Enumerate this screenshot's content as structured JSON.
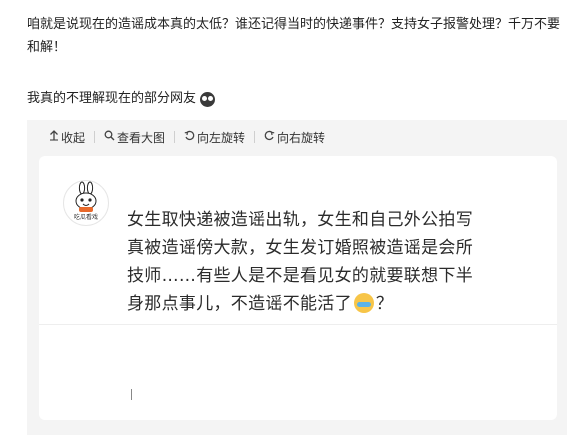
{
  "post": {
    "paragraph": "咱就是说现在的造谣成本真的太低？谁还记得当时的快递事件？支持女子报警处理？千万不要和解！",
    "line2": "我真的不理解现在的部分网友",
    "line2_emoji": "dark-round-face-emoji"
  },
  "toolbar": {
    "collapse_label": "收起",
    "collapse_icon": "collapse-up-icon",
    "view_large_label": "查看大图",
    "view_large_icon": "magnifier-icon",
    "rotate_left_label": "向左旋转",
    "rotate_left_icon": "rotate-left-icon",
    "rotate_right_label": "向右旋转",
    "rotate_right_icon": "rotate-right-icon"
  },
  "image": {
    "avatar_caption": "吃瓜看戏",
    "text_part1": "女生取快递被造谣出轨，女生和自己外公拍写真被造谣傍大款，女生发订婚照被造谣是会所技师……有些人是不是看见女的就要联想下半身那点事儿，不造谣不能活了",
    "emoji": "crying-face-emoji",
    "text_part2": "？"
  }
}
